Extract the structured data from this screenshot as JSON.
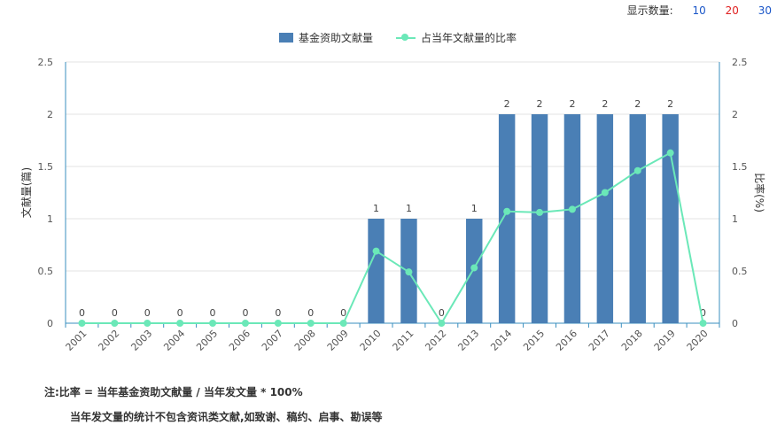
{
  "display_count": {
    "label": "显示数量:",
    "options": [
      "10",
      "20",
      "30"
    ],
    "colors": [
      "#1a56c8",
      "#e02020",
      "#1a56c8"
    ]
  },
  "notes": {
    "line1": "注:比率 = 当年基金资助文献量 / 当年发文量 * 100%",
    "line2": "当年发文量的统计不包含资讯类文献,如致谢、稿约、启事、勘误等"
  },
  "chart_data": {
    "type": "bar",
    "categories": [
      "2001",
      "2002",
      "2003",
      "2004",
      "2005",
      "2006",
      "2007",
      "2008",
      "2009",
      "2010",
      "2011",
      "2012",
      "2013",
      "2014",
      "2015",
      "2016",
      "2017",
      "2018",
      "2019",
      "2020"
    ],
    "series": [
      {
        "name": "基金资助文献量",
        "type": "bar",
        "axis": "left",
        "color": "#4a7fb5",
        "values": [
          0,
          0,
          0,
          0,
          0,
          0,
          0,
          0,
          0,
          1,
          1,
          0,
          1,
          2,
          2,
          2,
          2,
          2,
          2,
          0
        ]
      },
      {
        "name": "占当年文献量的比率",
        "type": "line",
        "axis": "right",
        "color": "#6be8b8",
        "values": [
          0,
          0,
          0,
          0,
          0,
          0,
          0,
          0,
          0,
          0.69,
          0.49,
          0,
          0.53,
          1.07,
          1.06,
          1.09,
          1.25,
          1.46,
          1.63,
          0
        ]
      }
    ],
    "ylabel": "文献量(篇)",
    "ylabel_right": "比率(%)",
    "ylim": [
      0,
      2.5
    ],
    "ylim_right": [
      0,
      2.5
    ],
    "yticks": [
      "0",
      "0.5",
      "1",
      "1.5",
      "2",
      "2.5"
    ],
    "grid": true,
    "legend_position": "top-center"
  }
}
